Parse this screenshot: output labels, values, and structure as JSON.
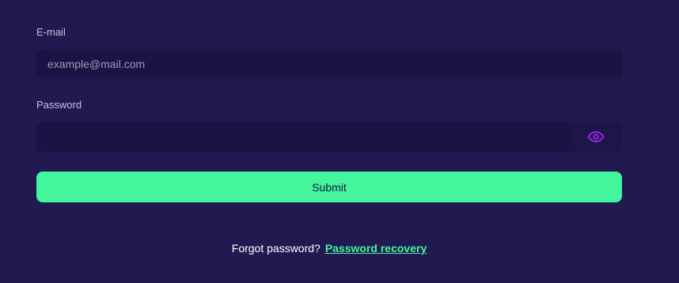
{
  "email": {
    "label": "E-mail",
    "placeholder": "example@mail.com",
    "value": ""
  },
  "password": {
    "label": "Password",
    "placeholder": "",
    "value": "",
    "toggle_icon": "eye-icon"
  },
  "submit": {
    "label": "Submit"
  },
  "footer": {
    "question": "Forgot password?",
    "link": "Password recovery"
  },
  "colors": {
    "background": "#211a51",
    "field": "#1a1344",
    "accent": "#43f59c",
    "icon": "#9b23e8"
  }
}
